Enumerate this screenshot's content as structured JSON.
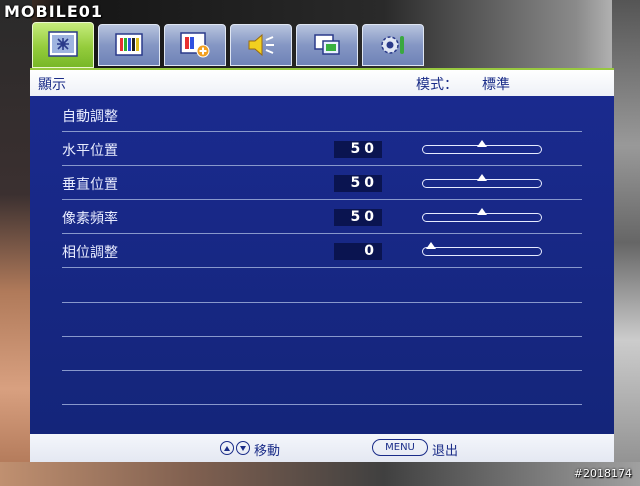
{
  "watermark": "MOBILE01",
  "photo_id": "#2018174",
  "tabs": [
    {
      "icon": "display-settings-icon",
      "active": true
    },
    {
      "icon": "picture-color-icon",
      "active": false
    },
    {
      "icon": "picture-advanced-icon",
      "active": false
    },
    {
      "icon": "audio-speaker-icon",
      "active": false
    },
    {
      "icon": "system-window-icon",
      "active": false
    },
    {
      "icon": "settings-gear-icon",
      "active": false
    }
  ],
  "header": {
    "title": "顯示",
    "mode_label": "模式：",
    "mode_value": "標準"
  },
  "rows": [
    {
      "label": "自動調整"
    },
    {
      "label": "水平位置",
      "value": "50",
      "level": 0.5
    },
    {
      "label": "垂直位置",
      "value": "50",
      "level": 0.5
    },
    {
      "label": "像素頻率",
      "value": "50",
      "level": 0.5
    },
    {
      "label": "相位調整",
      "value": "0",
      "level": 0.0
    }
  ],
  "footer": {
    "move_label": "移動",
    "menu_key": "MENU",
    "exit_label": "退出"
  },
  "colors": {
    "panel": "#1a2a8e",
    "active_tab": "#94cc3c",
    "tab": "#8597c4",
    "text_dark": "#1a2c88"
  }
}
